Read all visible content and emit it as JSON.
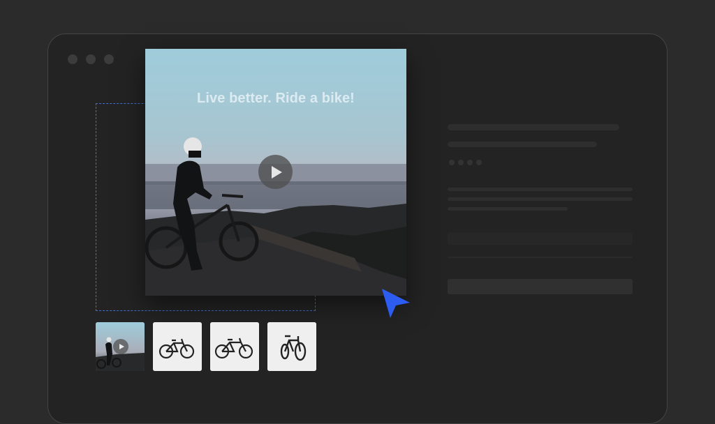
{
  "product": {
    "media_caption": "Live better. Ride a bike!"
  },
  "colors": {
    "background": "#2b2b2b",
    "window": "#232323",
    "accent": "#2c5cf0",
    "drop_zone_border": "#3d6fd4"
  },
  "icons": {
    "window_controls": [
      "window-dot-icon",
      "window-dot-icon",
      "window-dot-icon"
    ],
    "play": "play-icon",
    "cursor": "pointer-cursor-icon"
  },
  "gallery": {
    "thumbnails": [
      {
        "kind": "video",
        "subject": "rider-at-sunset"
      },
      {
        "kind": "image",
        "subject": "mountain-bike"
      },
      {
        "kind": "image",
        "subject": "mountain-bike"
      },
      {
        "kind": "image",
        "subject": "mountain-bike"
      }
    ]
  },
  "details": {
    "star_count": 4
  }
}
